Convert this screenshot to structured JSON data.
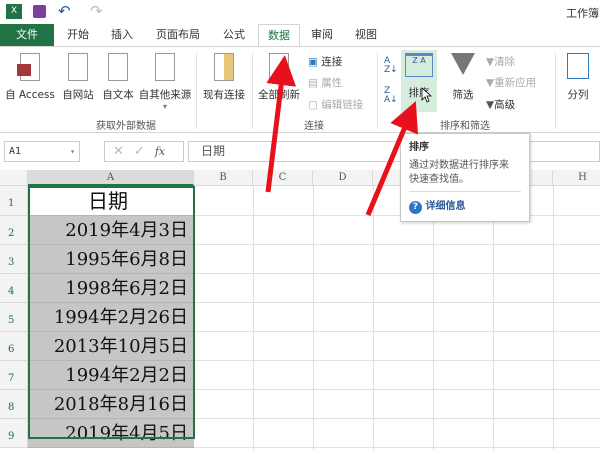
{
  "titlebar": {
    "title": "工作簿"
  },
  "tabs": [
    {
      "label": "文件"
    },
    {
      "label": "开始"
    },
    {
      "label": "插入"
    },
    {
      "label": "页面布局"
    },
    {
      "label": "公式"
    },
    {
      "label": "数据"
    },
    {
      "label": "审阅"
    },
    {
      "label": "视图"
    }
  ],
  "ribbon": {
    "external": {
      "access": "自 Access",
      "web": "自网站",
      "text": "自文本",
      "other": "自其他来源",
      "existing": "现有连接",
      "group": "获取外部数据"
    },
    "connections": {
      "refresh": "全部刷新",
      "connections": "连接",
      "properties": "属性",
      "edit_links": "编辑链接",
      "group": "连接"
    },
    "sort": {
      "sort": "排序",
      "filter": "筛选",
      "clear": "清除",
      "reapply": "重新应用",
      "advanced": "高级",
      "group": "排序和筛选"
    },
    "tools": {
      "split": "分列"
    }
  },
  "formula": {
    "namebox": "A1",
    "fx": "fx",
    "value": "日期"
  },
  "columns": [
    "A",
    "B",
    "C",
    "D",
    "H"
  ],
  "rows": [
    "1",
    "2",
    "3",
    "4",
    "5",
    "6",
    "7",
    "8",
    "9"
  ],
  "cells": [
    "日期",
    "2019年4月3日",
    "1995年6月8日",
    "1998年6月2日",
    "1994年2月26日",
    "2013年10月5日",
    "1994年2月2日",
    "2018年8月16日",
    "2019年4月5日"
  ],
  "tooltip": {
    "title": "排序",
    "body1": "通过对数据进行排序来",
    "body2": "快速查找值。",
    "link": "详细信息"
  },
  "colors": {
    "excel_green": "#217346",
    "arrow": "#e8111b"
  }
}
